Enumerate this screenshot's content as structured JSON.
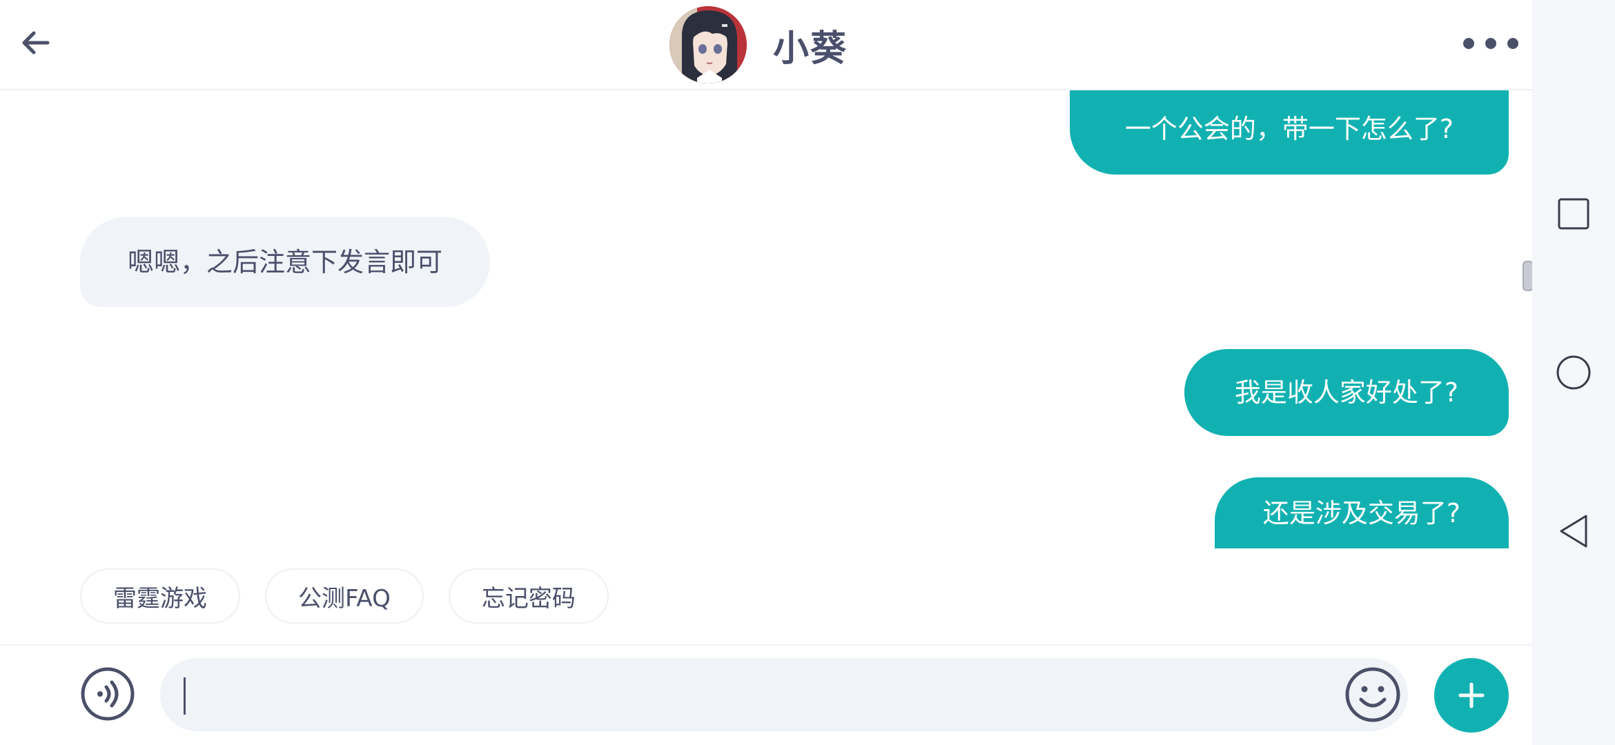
{
  "header": {
    "title": "小葵"
  },
  "messages": [
    {
      "side": "me",
      "text": "一个公会的，带一下怎么了?"
    },
    {
      "side": "other",
      "text": "嗯嗯，之后注意下发言即可"
    },
    {
      "side": "me",
      "text": "我是收人家好处了?"
    },
    {
      "side": "me",
      "text": "还是涉及交易了?"
    }
  ],
  "quick_replies": [
    "雷霆游戏",
    "公测FAQ",
    "忘记密码"
  ],
  "input": {
    "value": ""
  },
  "colors": {
    "accent": "#12b1b1",
    "bubble_other": "#f0f3f7",
    "text_dark": "#4a4f6b"
  },
  "icons": {
    "back": "back-arrow-icon",
    "more": "more-dots-icon",
    "voice": "voice-icon",
    "emoji": "emoji-icon",
    "plus": "plus-icon",
    "nav_recents": "square-icon",
    "nav_home": "circle-icon",
    "nav_back": "triangle-back-icon"
  }
}
